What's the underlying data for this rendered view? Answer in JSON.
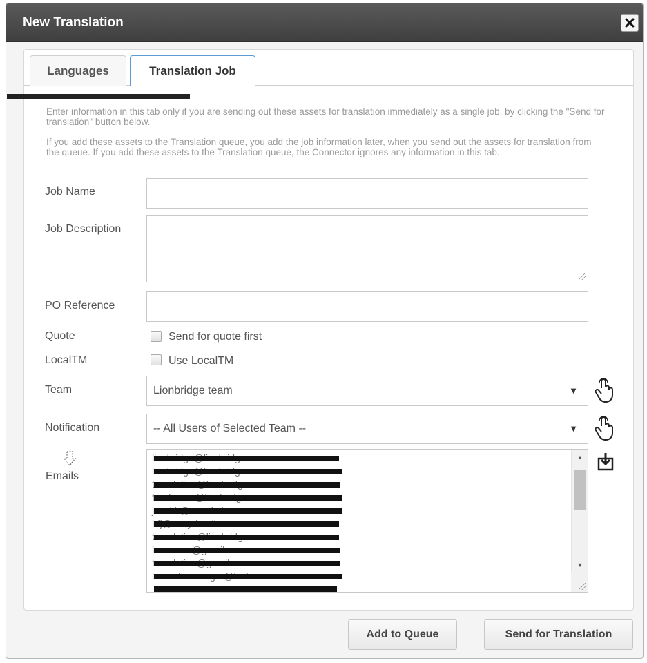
{
  "dialog": {
    "title": "New Translation",
    "close_icon": "close-icon"
  },
  "tabs": [
    {
      "label": "Languages",
      "active": false
    },
    {
      "label": "Translation Job",
      "active": true
    }
  ],
  "intro": {
    "paragraph1": "Enter information in this tab only if you are sending out these assets for translation immediately as a single job, by clicking the \"Send for translation\" button below.",
    "paragraph2": "If you add these assets to the Translation queue, you add the job information later, when you send out the assets for translation from the queue. If you add these assets to the Translation queue, the Connector ignores any information in this tab."
  },
  "form": {
    "job_name": {
      "label": "Job Name",
      "value": ""
    },
    "job_description": {
      "label": "Job Description",
      "value": ""
    },
    "po_reference": {
      "label": "PO Reference",
      "value": ""
    },
    "quote": {
      "label": "Quote",
      "checkbox_label": "Send for quote first",
      "checked": false
    },
    "localtm": {
      "label": "LocalTM",
      "checkbox_label": "Use LocalTM",
      "checked": false
    },
    "team": {
      "label": "Team",
      "selected": "Lionbridge team",
      "icon": "hand-pointer-icon"
    },
    "notification": {
      "label": "Notification",
      "selected": "-- All Users of Selected Team --",
      "icon": "hand-pointer-icon"
    },
    "emails": {
      "label": "Emails",
      "label_icon": "add-arrow-icon",
      "side_icon": "download-icon",
      "lines": [
        "lionbridge@lionbridge.com",
        "lionbridge@lionbridge.com",
        "translation@lionbridge.com",
        "freelancer@lionbridge.com",
        "j.smith@translation.com",
        "lrfj@sonyderail.com",
        "translation@lionbridge.com",
        "lmm.user@gmail.com",
        "translation@gmail.com",
        "lowerdomanager@lmiter.com"
      ]
    }
  },
  "buttons": {
    "add_to_queue": "Add to Queue",
    "send_for_translation": "Send for Translation"
  }
}
